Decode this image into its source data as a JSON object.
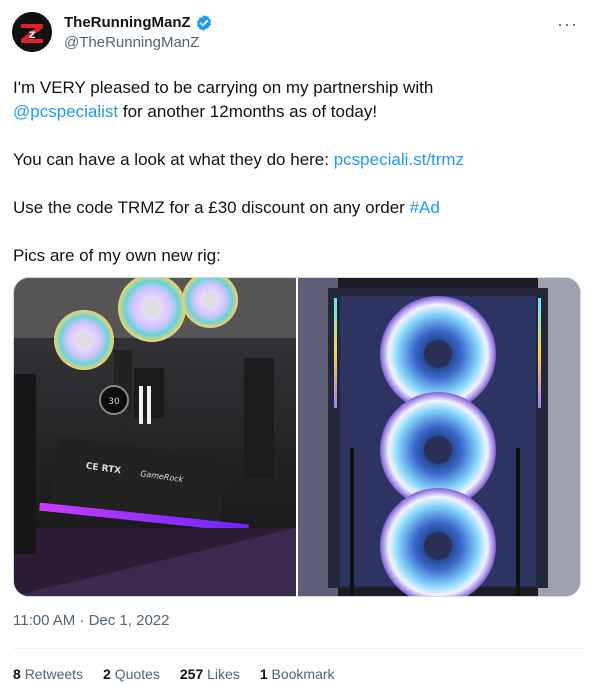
{
  "author": {
    "display_name": "TheRunningManZ",
    "handle": "@TheRunningManZ",
    "avatar_text": "Z"
  },
  "tweet": {
    "line1_part1": "I'm VERY pleased to be carrying on my partnership with",
    "line2_mention": "@pcspecialist",
    "line2_rest": " for another 12months as of today!",
    "para2_text": "You can have a look at what they do here: ",
    "para2_link": "pcspeciali.st/trmz",
    "para3_text": "Use the code TRMZ for a £30 discount on any order ",
    "para3_hashtag": "#Ad",
    "para4_text": "Pics are of my own new rig:"
  },
  "media": {
    "left_label": "CE RTX",
    "left_label2": "GameRock",
    "cooler_text": "30"
  },
  "timestamp": "11:00 AM · Dec 1, 2022",
  "stats": {
    "retweets_count": "8",
    "retweets_label": "Retweets",
    "quotes_count": "2",
    "quotes_label": "Quotes",
    "likes_count": "257",
    "likes_label": "Likes",
    "bookmarks_count": "1",
    "bookmarks_label": "Bookmark"
  },
  "colors": {
    "link": "#1d9bf0",
    "secondary": "#536471",
    "verified": "#1d9bf0"
  },
  "icons": [
    "verified-badge-icon",
    "more-options-icon"
  ]
}
